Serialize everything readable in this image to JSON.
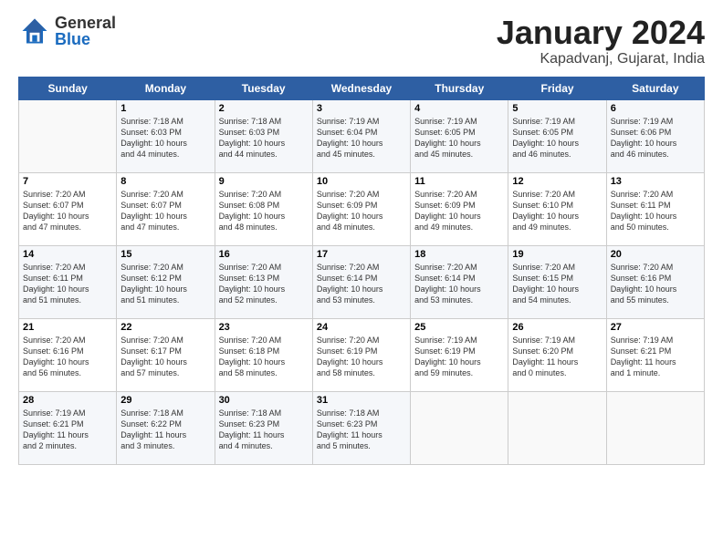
{
  "logo": {
    "general": "General",
    "blue": "Blue"
  },
  "title": "January 2024",
  "subtitle": "Kapadvanj, Gujarat, India",
  "days_of_week": [
    "Sunday",
    "Monday",
    "Tuesday",
    "Wednesday",
    "Thursday",
    "Friday",
    "Saturday"
  ],
  "weeks": [
    [
      {
        "day": "",
        "info": ""
      },
      {
        "day": "1",
        "info": "Sunrise: 7:18 AM\nSunset: 6:03 PM\nDaylight: 10 hours\nand 44 minutes."
      },
      {
        "day": "2",
        "info": "Sunrise: 7:18 AM\nSunset: 6:03 PM\nDaylight: 10 hours\nand 44 minutes."
      },
      {
        "day": "3",
        "info": "Sunrise: 7:19 AM\nSunset: 6:04 PM\nDaylight: 10 hours\nand 45 minutes."
      },
      {
        "day": "4",
        "info": "Sunrise: 7:19 AM\nSunset: 6:05 PM\nDaylight: 10 hours\nand 45 minutes."
      },
      {
        "day": "5",
        "info": "Sunrise: 7:19 AM\nSunset: 6:05 PM\nDaylight: 10 hours\nand 46 minutes."
      },
      {
        "day": "6",
        "info": "Sunrise: 7:19 AM\nSunset: 6:06 PM\nDaylight: 10 hours\nand 46 minutes."
      }
    ],
    [
      {
        "day": "7",
        "info": "Sunrise: 7:20 AM\nSunset: 6:07 PM\nDaylight: 10 hours\nand 47 minutes."
      },
      {
        "day": "8",
        "info": "Sunrise: 7:20 AM\nSunset: 6:07 PM\nDaylight: 10 hours\nand 47 minutes."
      },
      {
        "day": "9",
        "info": "Sunrise: 7:20 AM\nSunset: 6:08 PM\nDaylight: 10 hours\nand 48 minutes."
      },
      {
        "day": "10",
        "info": "Sunrise: 7:20 AM\nSunset: 6:09 PM\nDaylight: 10 hours\nand 48 minutes."
      },
      {
        "day": "11",
        "info": "Sunrise: 7:20 AM\nSunset: 6:09 PM\nDaylight: 10 hours\nand 49 minutes."
      },
      {
        "day": "12",
        "info": "Sunrise: 7:20 AM\nSunset: 6:10 PM\nDaylight: 10 hours\nand 49 minutes."
      },
      {
        "day": "13",
        "info": "Sunrise: 7:20 AM\nSunset: 6:11 PM\nDaylight: 10 hours\nand 50 minutes."
      }
    ],
    [
      {
        "day": "14",
        "info": "Sunrise: 7:20 AM\nSunset: 6:11 PM\nDaylight: 10 hours\nand 51 minutes."
      },
      {
        "day": "15",
        "info": "Sunrise: 7:20 AM\nSunset: 6:12 PM\nDaylight: 10 hours\nand 51 minutes."
      },
      {
        "day": "16",
        "info": "Sunrise: 7:20 AM\nSunset: 6:13 PM\nDaylight: 10 hours\nand 52 minutes."
      },
      {
        "day": "17",
        "info": "Sunrise: 7:20 AM\nSunset: 6:14 PM\nDaylight: 10 hours\nand 53 minutes."
      },
      {
        "day": "18",
        "info": "Sunrise: 7:20 AM\nSunset: 6:14 PM\nDaylight: 10 hours\nand 53 minutes."
      },
      {
        "day": "19",
        "info": "Sunrise: 7:20 AM\nSunset: 6:15 PM\nDaylight: 10 hours\nand 54 minutes."
      },
      {
        "day": "20",
        "info": "Sunrise: 7:20 AM\nSunset: 6:16 PM\nDaylight: 10 hours\nand 55 minutes."
      }
    ],
    [
      {
        "day": "21",
        "info": "Sunrise: 7:20 AM\nSunset: 6:16 PM\nDaylight: 10 hours\nand 56 minutes."
      },
      {
        "day": "22",
        "info": "Sunrise: 7:20 AM\nSunset: 6:17 PM\nDaylight: 10 hours\nand 57 minutes."
      },
      {
        "day": "23",
        "info": "Sunrise: 7:20 AM\nSunset: 6:18 PM\nDaylight: 10 hours\nand 58 minutes."
      },
      {
        "day": "24",
        "info": "Sunrise: 7:20 AM\nSunset: 6:19 PM\nDaylight: 10 hours\nand 58 minutes."
      },
      {
        "day": "25",
        "info": "Sunrise: 7:19 AM\nSunset: 6:19 PM\nDaylight: 10 hours\nand 59 minutes."
      },
      {
        "day": "26",
        "info": "Sunrise: 7:19 AM\nSunset: 6:20 PM\nDaylight: 11 hours\nand 0 minutes."
      },
      {
        "day": "27",
        "info": "Sunrise: 7:19 AM\nSunset: 6:21 PM\nDaylight: 11 hours\nand 1 minute."
      }
    ],
    [
      {
        "day": "28",
        "info": "Sunrise: 7:19 AM\nSunset: 6:21 PM\nDaylight: 11 hours\nand 2 minutes."
      },
      {
        "day": "29",
        "info": "Sunrise: 7:18 AM\nSunset: 6:22 PM\nDaylight: 11 hours\nand 3 minutes."
      },
      {
        "day": "30",
        "info": "Sunrise: 7:18 AM\nSunset: 6:23 PM\nDaylight: 11 hours\nand 4 minutes."
      },
      {
        "day": "31",
        "info": "Sunrise: 7:18 AM\nSunset: 6:23 PM\nDaylight: 11 hours\nand 5 minutes."
      },
      {
        "day": "",
        "info": ""
      },
      {
        "day": "",
        "info": ""
      },
      {
        "day": "",
        "info": ""
      }
    ]
  ]
}
